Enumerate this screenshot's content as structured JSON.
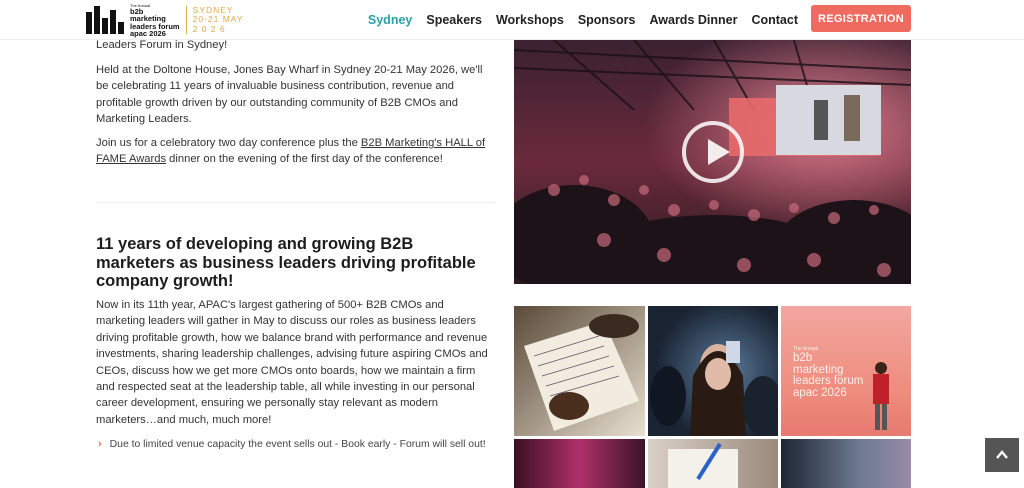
{
  "header": {
    "logo": {
      "tiny": "The Annual",
      "line1": "b2b",
      "line2": "marketing",
      "line3": "leaders forum",
      "line4": "apac 2026",
      "city": "SYDNEY",
      "dates": "20-21 MAY",
      "year": "2 0 2 6"
    },
    "nav": [
      "Sydney",
      "Speakers",
      "Workshops",
      "Sponsors",
      "Awards Dinner",
      "Contact"
    ],
    "active_nav": "Sydney",
    "registration_label": "REGISTRATION"
  },
  "content": {
    "intro_tail": "Leaders Forum in Sydney!",
    "para1": "Held at the Doltone House, Jones Bay Wharf in Sydney 20-21 May 2026, we'll be celebrating 11 years of invaluable business contribution, revenue and profitable growth driven by our outstanding community of B2B CMOs and Marketing Leaders.",
    "para2_before": "Join us for a celebratory two day conference plus the ",
    "para2_link": "B2B Marketing's HALL of FAME Awards",
    "para2_after": " dinner  on the evening of the first day of the conference!",
    "heading": "11 years of developing and growing B2B marketers as business leaders driving profitable company growth!",
    "para3": "Now in its 11th year, APAC's largest gathering of 500+ B2B CMOs and marketing leaders will gather in May to discuss our roles as business leaders driving profitable growth, how we balance brand with performance and revenue investments, sharing leadership challenges, advising  future aspiring CMOs and CEOs, discuss how we get more CMOs onto boards, how we maintain a firm and respected seat at the leadership table, all while investing in our personal career development, ensuring we personally stay relevant as modern marketers…and much, much more!",
    "bullet": "Due to limited venue capacity the event sells out - Book early - Forum will sell out!"
  },
  "gallery": {
    "thumb3_tiny": "The Annual",
    "thumb3_lines": [
      "b2b",
      "marketing",
      "leaders forum",
      "apac 2026"
    ]
  },
  "colors": {
    "accent_teal": "#2aa1a6",
    "registration_bg": "#ef6a5f",
    "logo_gold": "#e5a84b"
  },
  "icons": {
    "play": "play-icon",
    "scroll_top": "chevron-up-icon",
    "bullet": "chevron-right-icon"
  }
}
